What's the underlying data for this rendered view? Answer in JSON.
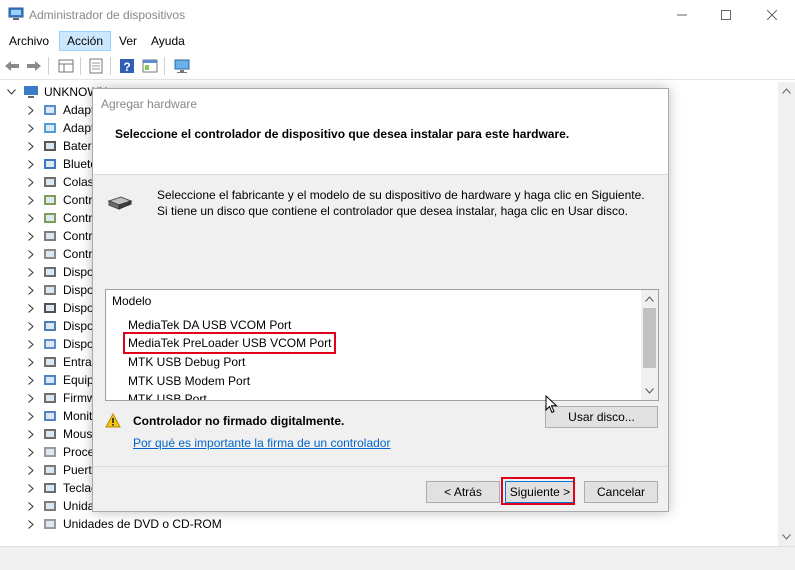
{
  "window": {
    "title": "Administrador de dispositivos"
  },
  "menu": [
    "Archivo",
    "Acción",
    "Ver",
    "Ayuda"
  ],
  "tree": {
    "root": "UNKNOWN",
    "items": [
      {
        "label": "Adaptadores de audio",
        "icon": "audio-adapter-icon"
      },
      {
        "label": "Adaptadores de red",
        "icon": "network-adapter-icon"
      },
      {
        "label": "Baterías",
        "icon": "battery-icon"
      },
      {
        "label": "Bluetooth",
        "icon": "bluetooth-icon"
      },
      {
        "label": "Colas de impresión",
        "icon": "printer-icon"
      },
      {
        "label": "Controladoras",
        "icon": "controller-icon"
      },
      {
        "label": "Controladoras",
        "icon": "controller-icon"
      },
      {
        "label": "Controladoras",
        "icon": "usb-controller-icon"
      },
      {
        "label": "Controladoras",
        "icon": "sound-controller-icon"
      },
      {
        "label": "Dispositivos",
        "icon": "device-icon"
      },
      {
        "label": "Dispositivos",
        "icon": "hid-icon"
      },
      {
        "label": "Dispositivos",
        "icon": "portable-device-icon"
      },
      {
        "label": "Dispositivos",
        "icon": "software-device-icon"
      },
      {
        "label": "Dispositivos",
        "icon": "system-device-icon"
      },
      {
        "label": "Entradas",
        "icon": "audio-input-icon"
      },
      {
        "label": "Equipo",
        "icon": "computer-icon"
      },
      {
        "label": "Firmware",
        "icon": "firmware-icon"
      },
      {
        "label": "Monitores",
        "icon": "monitor-icon"
      },
      {
        "label": "Mouse",
        "icon": "mouse-icon"
      },
      {
        "label": "Procesadores",
        "icon": "processor-icon"
      },
      {
        "label": "Puertos",
        "icon": "port-icon"
      },
      {
        "label": "Teclados",
        "icon": "keyboard-icon"
      },
      {
        "label": "Unidades de disco",
        "icon": "disk-drive-icon"
      },
      {
        "label": "Unidades de DVD o CD-ROM",
        "icon": "dvd-drive-icon"
      }
    ],
    "visible_labels": [
      "Adapt",
      "Adapt",
      "Bater",
      "Blueto",
      "Colas",
      "Contr",
      "Contr",
      "Contr",
      "Contr",
      "Dispo",
      "Dispo",
      "Dispo",
      "Dispo",
      "Dispo",
      "Entrac",
      "Equip",
      "Firmw",
      "Monit",
      "Mous",
      "Proce",
      "Puerte",
      "Teclac",
      "Unidades de disco",
      "Unidades de DVD o CD-ROM"
    ]
  },
  "dialog": {
    "title": "Agregar hardware",
    "heading": "Seleccione el controlador de dispositivo que desea instalar para este hardware.",
    "description": "Seleccione el fabricante y el modelo de su dispositivo de hardware y haga clic en Siguiente. Si tiene un disco que contiene el controlador que desea instalar, haga clic en  Usar disco.",
    "list_header": "Modelo",
    "models": [
      "MediaTek DA USB VCOM Port",
      "MediaTek PreLoader USB VCOM Port",
      "MTK USB Debug Port",
      "MTK USB Modem Port",
      "MTK USB Port"
    ],
    "highlighted_model": "MediaTek PreLoader USB VCOM Port",
    "warning": "Controlador no firmado digitalmente.",
    "warning_link": "Por qué es importante la firma de un controlador",
    "buttons": {
      "have_disk": "Usar disco...",
      "back": "< Atrás",
      "next": "Siguiente >",
      "cancel": "Cancelar"
    }
  },
  "colors": {
    "highlight_red": "#e0001b",
    "link_blue": "#0066cc",
    "menu_active": "#cce8ff"
  }
}
